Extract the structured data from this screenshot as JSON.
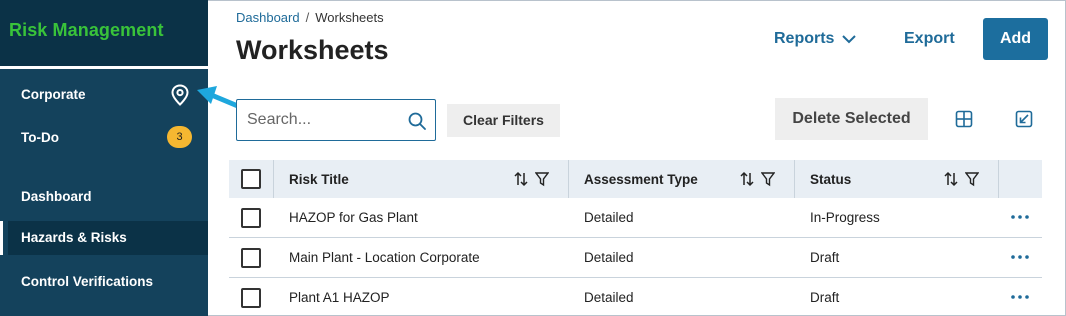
{
  "sidebar": {
    "app_title": "Risk Management",
    "items": [
      {
        "label": "Corporate"
      },
      {
        "label": "To-Do",
        "badge": "3"
      },
      {
        "label": "Dashboard"
      },
      {
        "label": "Hazards & Risks",
        "active": true
      },
      {
        "label": "Control Verifications"
      }
    ],
    "accent_color": "#39c33a",
    "badge_color": "#f5b731"
  },
  "header": {
    "breadcrumb": [
      "Dashboard",
      "Worksheets"
    ],
    "title": "Worksheets",
    "reports_label": "Reports",
    "export_label": "Export",
    "add_label": "Add"
  },
  "toolbar": {
    "search_placeholder": "Search...",
    "search_value": "",
    "clear_filters_label": "Clear Filters",
    "delete_selected_label": "Delete Selected"
  },
  "table": {
    "columns": [
      "Risk Title",
      "Assessment Type",
      "Status"
    ],
    "rows": [
      {
        "title": "HAZOP for Gas Plant",
        "assessment_type": "Detailed",
        "status": "In-Progress"
      },
      {
        "title": "Main Plant - Location Corporate",
        "assessment_type": "Detailed",
        "status": "Draft"
      },
      {
        "title": "Plant A1 HAZOP",
        "assessment_type": "Detailed",
        "status": "Draft"
      }
    ]
  },
  "colors": {
    "sidebar_bg": "#14425c",
    "sidebar_header_bg": "#0b3247",
    "primary": "#1c6e9e",
    "link": "#1f6b99",
    "annotation_arrow": "#1ea7dd"
  }
}
